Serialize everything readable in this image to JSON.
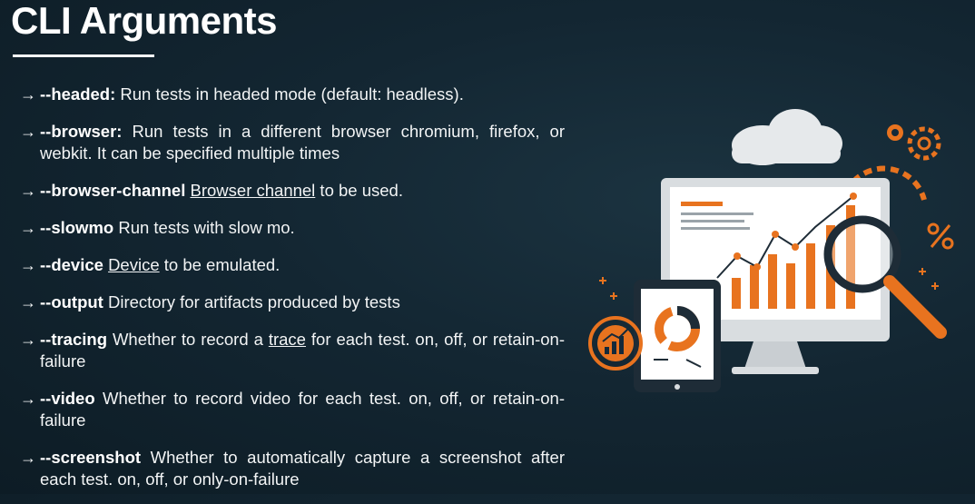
{
  "slide": {
    "title": "CLI Arguments",
    "items": [
      {
        "arrow": "→",
        "flag": "--headed:",
        "text": " Run tests in headed mode (default: headless)."
      },
      {
        "arrow": "→",
        "flag": "--browser:",
        "text": " Run tests in a different browser chromium, firefox, or webkit. It can be specified multiple times"
      },
      {
        "arrow": "→",
        "flag": "--browser-channel",
        "link": "Browser channel",
        "text": " to be used."
      },
      {
        "arrow": "→",
        "flag": "--slowmo",
        "text": " Run tests with slow mo."
      },
      {
        "arrow": "→",
        "flag": "--device",
        "link": "Device",
        "text": " to be emulated."
      },
      {
        "arrow": "→",
        "flag": "--output",
        "text": " Directory for artifacts produced by tests"
      },
      {
        "arrow": "→",
        "flag": "--tracing",
        "text_before": " Whether to record a ",
        "link": "trace",
        "text": " for each test. on, off, or retain-on-failure"
      },
      {
        "arrow": "→",
        "flag": "--video",
        "text": " Whether to record video for each test. on, off, or retain-on-failure"
      },
      {
        "arrow": "→",
        "flag": "--screenshot",
        "text": " Whether to automatically capture a screenshot after each test. on, off, or only-on-failure"
      }
    ]
  },
  "illustration": {
    "icons": [
      "cloud-icon",
      "gear-icon",
      "percent-icon",
      "magnifier-icon",
      "monitor-icon",
      "tablet-icon",
      "growth-chart-icon",
      "sparkle-icon"
    ],
    "colors": {
      "accent": "#e8731f",
      "monitor": "#d9dde0",
      "cloud": "#e6e9eb"
    }
  }
}
